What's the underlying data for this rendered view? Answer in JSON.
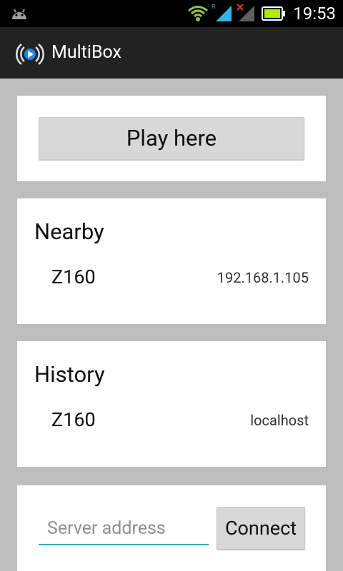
{
  "status_bar": {
    "time": "19:53",
    "icons": [
      "android-icon",
      "wifi-icon",
      "signal-icon",
      "signal-off-icon",
      "battery-icon"
    ],
    "colors": {
      "background": "#000000",
      "battery": "#aeea00",
      "wifi": "#8bc34a",
      "signal": "#33b5e5"
    }
  },
  "action_bar": {
    "app_title": "MultiBox",
    "app_icon": "multibox-logo-icon"
  },
  "play_card": {
    "button_label": "Play here"
  },
  "nearby": {
    "title": "Nearby",
    "items": [
      {
        "name": "Z160",
        "address": "192.168.1.105"
      }
    ]
  },
  "history": {
    "title": "History",
    "items": [
      {
        "name": "Z160",
        "address": "localhost"
      }
    ]
  },
  "connect_card": {
    "placeholder": "Server address",
    "value": "",
    "button_label": "Connect"
  },
  "colors": {
    "page_background": "#bdbdbd",
    "card_background": "#ffffff",
    "accent": "#34a8c8"
  }
}
